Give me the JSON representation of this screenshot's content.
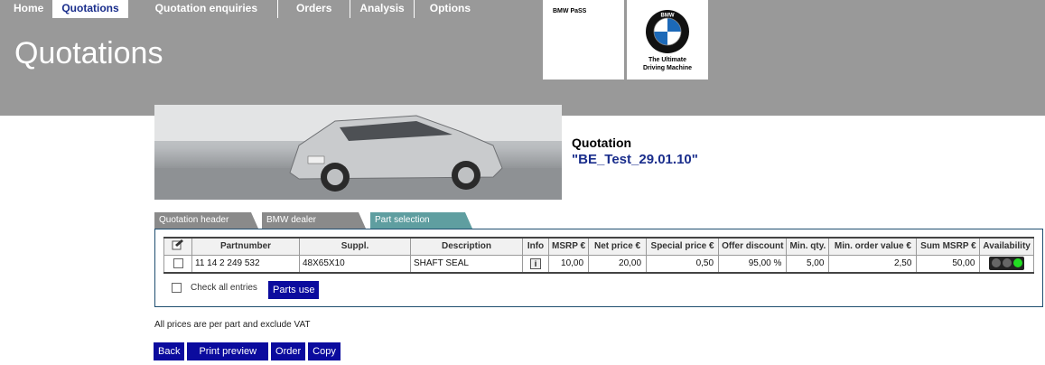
{
  "nav": {
    "items": [
      {
        "label": "Home"
      },
      {
        "label": "Quotations"
      },
      {
        "label": "Quotation enquiries"
      },
      {
        "label": "Orders"
      },
      {
        "label": "Analysis"
      },
      {
        "label": "Options"
      }
    ]
  },
  "header": {
    "title": "Quotations",
    "brand_small": "BMW PaSS",
    "tagline_1": "The Ultimate",
    "tagline_2": "Driving Machine"
  },
  "quotation": {
    "label": "Quotation",
    "name": "\"BE_Test_29.01.10\""
  },
  "tabs": [
    {
      "label": "Quotation header"
    },
    {
      "label": "BMW dealer"
    },
    {
      "label": "Part selection"
    }
  ],
  "table": {
    "headers": [
      "Partnumber",
      "Suppl.",
      "Description",
      "Info",
      "MSRP €",
      "Net price  €",
      "Special price €",
      "Offer discount",
      "Min. qty.",
      "Min. order value €",
      "Sum MSRP €",
      "Availability"
    ],
    "rows": [
      {
        "partnumber": "11 14 2 249 532",
        "suppl": "48X65X10",
        "description": "SHAFT SEAL",
        "msrp": "10,00",
        "net_price": "20,00",
        "special_price": "0,50",
        "offer_discount": "95,00 %",
        "min_qty": "5,00",
        "min_order_value": "2,50",
        "sum_msrp": "50,00",
        "availability": "green"
      }
    ]
  },
  "check_all_label": "Check all entries",
  "parts_use_label": "Parts use",
  "note": "All prices are per part and exclude VAT",
  "buttons": {
    "back": "Back",
    "print_preview": "Print preview",
    "order": "Order",
    "copy": "Copy"
  },
  "colors": {
    "header_bg": "#999999",
    "accent_blue": "#1a2e8c",
    "button_blue": "#0b0b9e",
    "active_tab": "#5f9ea0",
    "availability_on": "#22dd22"
  }
}
